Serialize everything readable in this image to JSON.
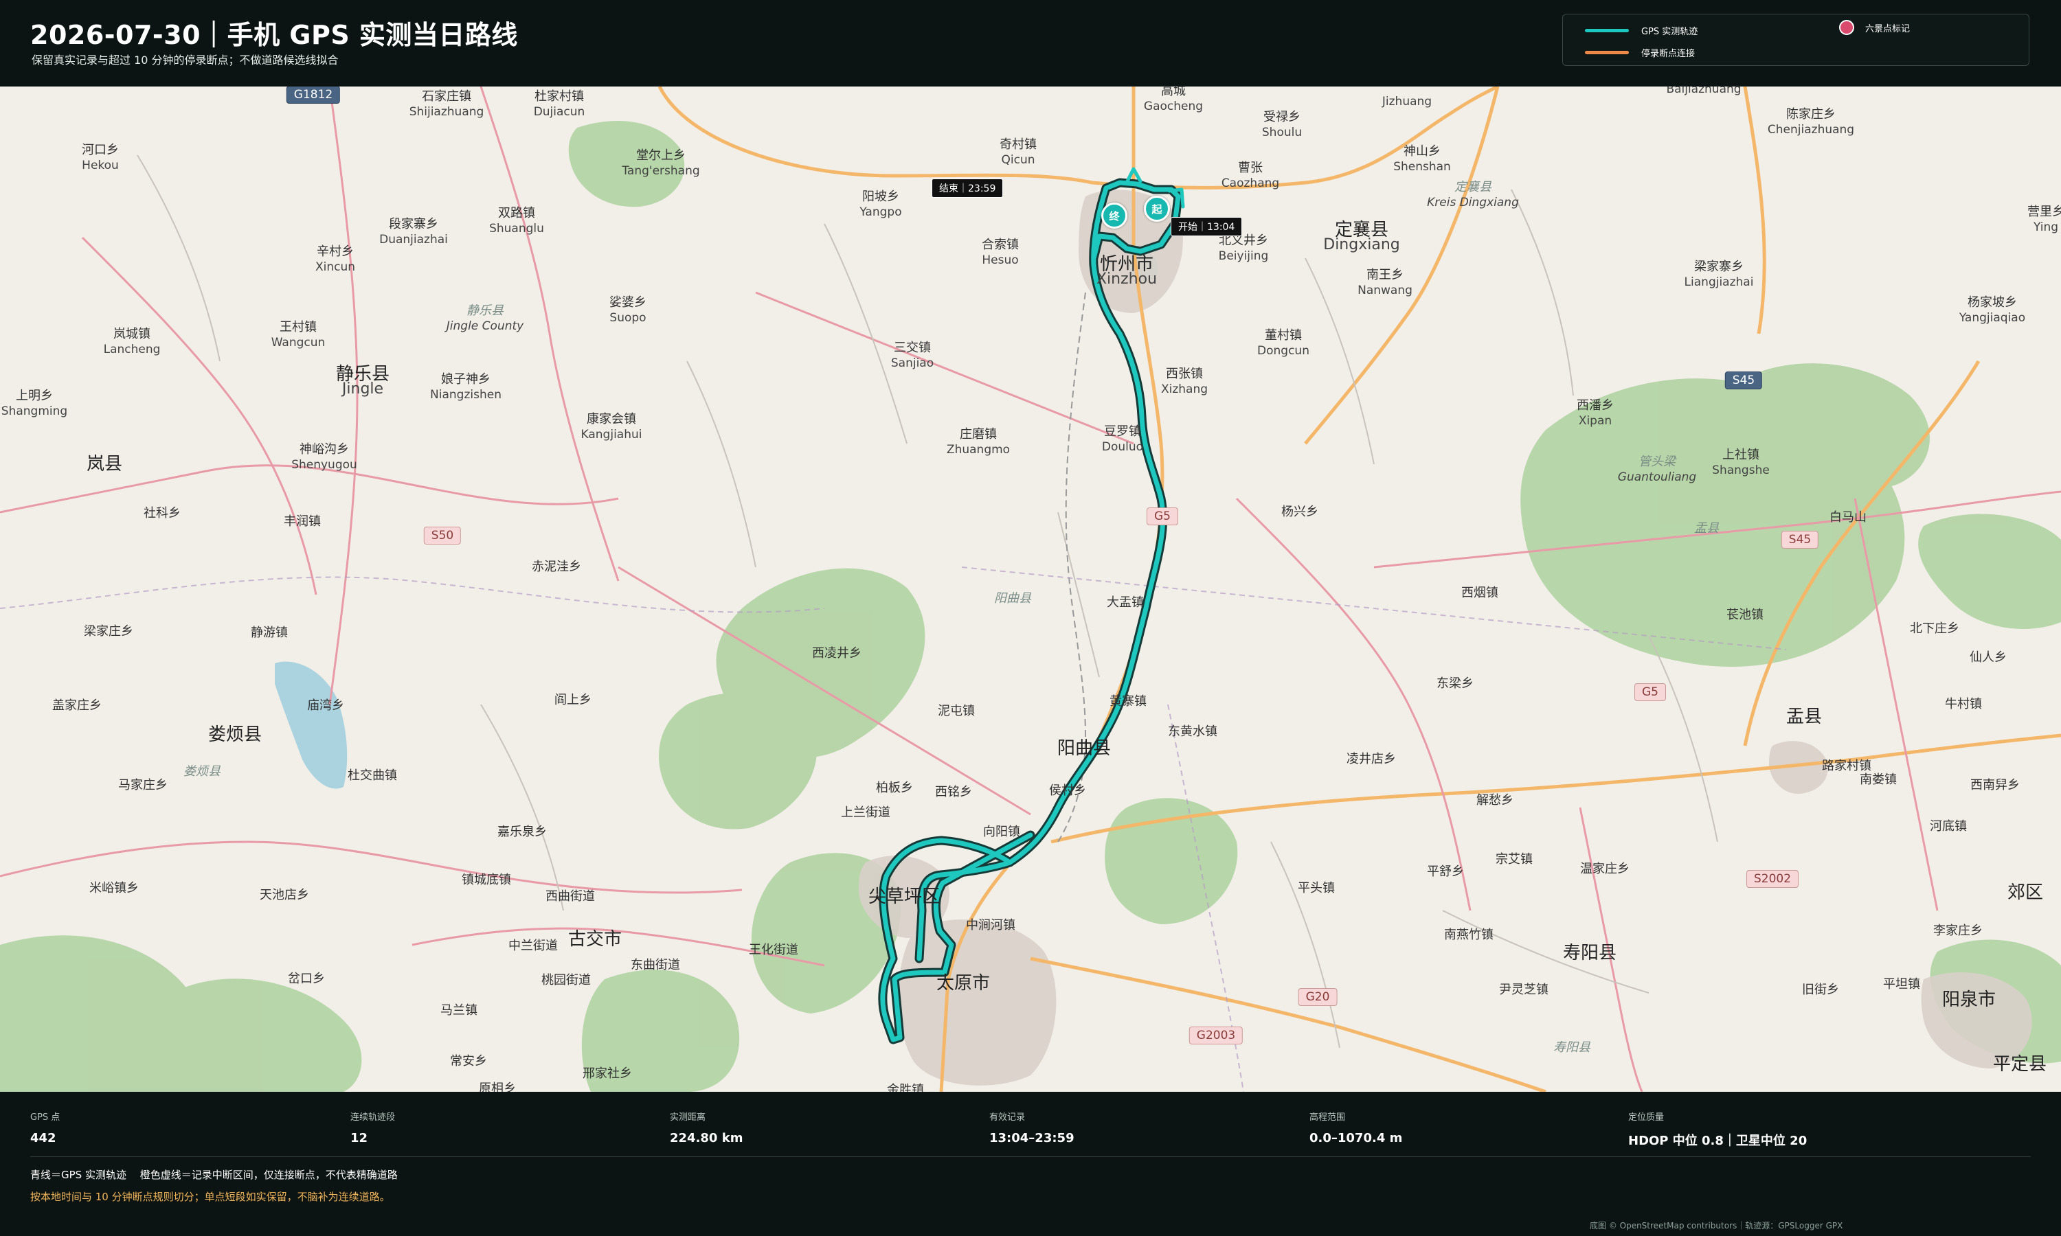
{
  "header": {
    "title": "2026-07-30｜手机 GPS 实测当日路线",
    "subtitle": "保留真实记录与超过 10 分钟的停录断点；不做道路候选线拟合"
  },
  "legend": {
    "gps_track": "GPS 实测轨迹",
    "gap_connector": "停录断点连接",
    "landmark": "六景点标记",
    "colors": {
      "track": "#1ec8be",
      "gap": "#f08a4b",
      "landmark": "#d94a6e"
    }
  },
  "map": {
    "markers": {
      "start_badge": "起",
      "end_badge": "终"
    },
    "tags": {
      "start": "开始｜13:04",
      "end": "结束｜23:59"
    },
    "shields": [
      {
        "id": "g1812",
        "label": "G1812",
        "kind": "g"
      },
      {
        "id": "s45a",
        "label": "S45",
        "kind": "g"
      },
      {
        "id": "s50",
        "label": "S50",
        "kind": "s"
      },
      {
        "id": "s45b",
        "label": "S45",
        "kind": "s"
      },
      {
        "id": "g5a",
        "label": "G5",
        "kind": "s"
      },
      {
        "id": "g5b",
        "label": "G5",
        "kind": "s"
      },
      {
        "id": "s2002",
        "label": "S2002",
        "kind": "s"
      },
      {
        "id": "g20",
        "label": "G20",
        "kind": "s"
      },
      {
        "id": "g2003",
        "label": "G2003",
        "kind": "s"
      }
    ],
    "places": [
      {
        "id": "p1",
        "zh": "石家庄镇",
        "py": "Shijiazhuang"
      },
      {
        "id": "p2",
        "zh": "杜家村镇",
        "py": "Dujiacun"
      },
      {
        "id": "p3",
        "zh": "河口乡",
        "py": "Hekou"
      },
      {
        "id": "p4",
        "zh": "堂尔上乡",
        "py": "Tang'ershang"
      },
      {
        "id": "p5",
        "zh": "奇村镇",
        "py": "Qicun"
      },
      {
        "id": "p6",
        "zh": "高城",
        "py": "Gaocheng"
      },
      {
        "id": "p7",
        "zh": "受禄乡",
        "py": "Shoulu"
      },
      {
        "id": "p8",
        "zh": "",
        "py": "Jizhuang"
      },
      {
        "id": "p9",
        "zh": "神山乡",
        "py": "Shenshan"
      },
      {
        "id": "p10",
        "zh": "",
        "py": "Baijiazhuang"
      },
      {
        "id": "p11",
        "zh": "陈家庄乡",
        "py": "Chenjiazhuang"
      },
      {
        "id": "p12",
        "zh": "段家寨乡",
        "py": "Duanjiazhai"
      },
      {
        "id": "p13",
        "zh": "双路镇",
        "py": "Shuanglu"
      },
      {
        "id": "p14",
        "zh": "阳坡乡",
        "py": "Yangpo"
      },
      {
        "id": "p15",
        "zh": "曹张",
        "py": "Caozhang"
      },
      {
        "id": "p16",
        "zh": "合索镇",
        "py": "Hesuo"
      },
      {
        "id": "p17",
        "zh": "北义井乡",
        "py": "Beiyijing"
      },
      {
        "id": "p18",
        "zh": "辛村乡",
        "py": "Xincun"
      },
      {
        "id": "p19",
        "zh": "南王乡",
        "py": "Nanwang"
      },
      {
        "id": "p20",
        "zh": "梁家寨乡",
        "py": "Liangjiazhai"
      },
      {
        "id": "p21",
        "zh": "杨家坡乡",
        "py": "Yangjiaqiao"
      },
      {
        "id": "p22",
        "zh": "营里乡",
        "py": "Ying"
      },
      {
        "id": "p23",
        "zh": "岚城镇",
        "py": "Lancheng"
      },
      {
        "id": "p24",
        "zh": "王村镇",
        "py": "Wangcun"
      },
      {
        "id": "p25",
        "zh": "娑婆乡",
        "py": "Suopo"
      },
      {
        "id": "p26",
        "zh": "三交镇",
        "py": "Sanjiao"
      },
      {
        "id": "p27",
        "zh": "董村镇",
        "py": "Dongcun"
      },
      {
        "id": "p28",
        "zh": "娘子神乡",
        "py": "Niangzishen"
      },
      {
        "id": "p29",
        "zh": "西张镇",
        "py": "Xizhang"
      },
      {
        "id": "p30",
        "zh": "上明乡",
        "py": "Shangming"
      },
      {
        "id": "p31",
        "zh": "康家会镇",
        "py": "Kangjiahui"
      },
      {
        "id": "p32",
        "zh": "庄磨镇",
        "py": "Zhuangmo"
      },
      {
        "id": "p33",
        "zh": "豆罗镇",
        "py": "Douluo"
      },
      {
        "id": "p34",
        "zh": "西潘乡",
        "py": "Xipan"
      },
      {
        "id": "p35",
        "zh": "上社镇",
        "py": "Shangshe"
      },
      {
        "id": "p36",
        "zh": "神峪沟乡",
        "py": "Shenyugou"
      },
      {
        "id": "p37",
        "zh": "杨兴乡",
        "py": ""
      },
      {
        "id": "p38",
        "zh": "社科乡",
        "py": ""
      },
      {
        "id": "p39",
        "zh": "丰润镇",
        "py": ""
      },
      {
        "id": "p40",
        "zh": "白马山",
        "py": ""
      },
      {
        "id": "p41",
        "zh": "赤泥洼乡",
        "py": ""
      },
      {
        "id": "p42",
        "zh": "大盂镇",
        "py": ""
      },
      {
        "id": "p43",
        "zh": "西烟镇",
        "py": ""
      },
      {
        "id": "p44",
        "zh": "苌池镇",
        "py": ""
      },
      {
        "id": "p45",
        "zh": "北下庄乡",
        "py": ""
      },
      {
        "id": "p46",
        "zh": "梁家庄乡",
        "py": ""
      },
      {
        "id": "p47",
        "zh": "静游镇",
        "py": ""
      },
      {
        "id": "p48",
        "zh": "西凌井乡",
        "py": ""
      },
      {
        "id": "p49",
        "zh": "仙人乡",
        "py": ""
      },
      {
        "id": "p50",
        "zh": "东梁乡",
        "py": ""
      },
      {
        "id": "p51",
        "zh": "黄寨镇",
        "py": ""
      },
      {
        "id": "p52",
        "zh": "盖家庄乡",
        "py": ""
      },
      {
        "id": "p53",
        "zh": "阎上乡",
        "py": ""
      },
      {
        "id": "p54",
        "zh": "泥屯镇",
        "py": ""
      },
      {
        "id": "p55",
        "zh": "庙湾乡",
        "py": ""
      },
      {
        "id": "p56",
        "zh": "东黄水镇",
        "py": ""
      },
      {
        "id": "p57",
        "zh": "牛村镇",
        "py": ""
      },
      {
        "id": "p58",
        "zh": "凌井店乡",
        "py": ""
      },
      {
        "id": "p59",
        "zh": "杜交曲镇",
        "py": ""
      },
      {
        "id": "p60",
        "zh": "马家庄乡",
        "py": ""
      },
      {
        "id": "p61",
        "zh": "柏板乡",
        "py": ""
      },
      {
        "id": "p62",
        "zh": "西铭乡",
        "py": ""
      },
      {
        "id": "p63",
        "zh": "侯村乡",
        "py": ""
      },
      {
        "id": "p64",
        "zh": "南娄镇",
        "py": ""
      },
      {
        "id": "p65",
        "zh": "路家村镇",
        "py": ""
      },
      {
        "id": "p66",
        "zh": "解愁乡",
        "py": ""
      },
      {
        "id": "p67",
        "zh": "西南舁乡",
        "py": ""
      },
      {
        "id": "p68",
        "zh": "上兰街道",
        "py": ""
      },
      {
        "id": "p69",
        "zh": "嘉乐泉乡",
        "py": ""
      },
      {
        "id": "p70",
        "zh": "向阳镇",
        "py": ""
      },
      {
        "id": "p71",
        "zh": "河底镇",
        "py": ""
      },
      {
        "id": "p72",
        "zh": "平舒乡",
        "py": ""
      },
      {
        "id": "p73",
        "zh": "宗艾镇",
        "py": ""
      },
      {
        "id": "p74",
        "zh": "温家庄乡",
        "py": ""
      },
      {
        "id": "p75",
        "zh": "镇城底镇",
        "py": ""
      },
      {
        "id": "p76",
        "zh": "西曲街道",
        "py": ""
      },
      {
        "id": "p77",
        "zh": "平头镇",
        "py": ""
      },
      {
        "id": "p78",
        "zh": "米峪镇乡",
        "py": ""
      },
      {
        "id": "p79",
        "zh": "天池店乡",
        "py": ""
      },
      {
        "id": "p80",
        "zh": "中涧河镇",
        "py": ""
      },
      {
        "id": "p81",
        "zh": "南燕竹镇",
        "py": ""
      },
      {
        "id": "p82",
        "zh": "李家庄乡",
        "py": ""
      },
      {
        "id": "p83",
        "zh": "中兰街道",
        "py": ""
      },
      {
        "id": "p84",
        "zh": "王化街道",
        "py": ""
      },
      {
        "id": "p85",
        "zh": "桃园街道",
        "py": ""
      },
      {
        "id": "p86",
        "zh": "东曲街道",
        "py": ""
      },
      {
        "id": "p87",
        "zh": "尹灵芝镇",
        "py": ""
      },
      {
        "id": "p88",
        "zh": "旧街乡",
        "py": ""
      },
      {
        "id": "p89",
        "zh": "平坦镇",
        "py": ""
      },
      {
        "id": "p90",
        "zh": "岔口乡",
        "py": ""
      },
      {
        "id": "p91",
        "zh": "马兰镇",
        "py": ""
      },
      {
        "id": "p92",
        "zh": "常安乡",
        "py": ""
      },
      {
        "id": "p93",
        "zh": "邢家社乡",
        "py": ""
      },
      {
        "id": "p94",
        "zh": "原相乡",
        "py": ""
      },
      {
        "id": "p95",
        "zh": "金胜镇",
        "py": ""
      },
      {
        "id": "p96",
        "zh": "平定县",
        "py": ""
      },
      {
        "id": "p97",
        "zh": "郊区",
        "py": ""
      }
    ],
    "cities": [
      {
        "id": "c1",
        "zh": "定襄县",
        "py": "Dingxiang"
      },
      {
        "id": "c2",
        "zh": "静乐县",
        "py": "Jingle"
      },
      {
        "id": "c3",
        "zh": "岚县",
        "py": ""
      },
      {
        "id": "c4",
        "zh": "忻州市",
        "py": "Xinzhou"
      },
      {
        "id": "c5",
        "zh": "盂县",
        "py": ""
      },
      {
        "id": "c6",
        "zh": "娄烦县",
        "py": ""
      },
      {
        "id": "c7",
        "zh": "阳曲县",
        "py": ""
      },
      {
        "id": "c8",
        "zh": "古交市",
        "py": ""
      },
      {
        "id": "c9",
        "zh": "尖草坪区",
        "py": ""
      },
      {
        "id": "c10",
        "zh": "太原市",
        "py": ""
      },
      {
        "id": "c11",
        "zh": "寿阳县",
        "py": ""
      },
      {
        "id": "c12",
        "zh": "阳泉市",
        "py": ""
      }
    ],
    "muted": [
      {
        "id": "m1",
        "zh": "静乐县",
        "py": "Jingle County"
      },
      {
        "id": "m2",
        "zh": "定襄县",
        "py": "Kreis Dingxiang"
      },
      {
        "id": "m3",
        "zh": "管头梁",
        "py": "Guantouliang"
      },
      {
        "id": "m4",
        "zh": "阳曲县",
        "py": ""
      },
      {
        "id": "m5",
        "zh": "娄烦县",
        "py": ""
      },
      {
        "id": "m6",
        "zh": "盂县",
        "py": ""
      },
      {
        "id": "m7",
        "zh": "寿阳县",
        "py": ""
      }
    ]
  },
  "stats": [
    {
      "label": "GPS 点",
      "value": "442"
    },
    {
      "label": "连续轨迹段",
      "value": "12"
    },
    {
      "label": "实测距离",
      "value": "224.80 km"
    },
    {
      "label": "有效记录",
      "value": "13:04–23:59"
    },
    {
      "label": "高程范围",
      "value": "0.0–1070.4 m"
    },
    {
      "label": "定位质量",
      "value": "HDOP 中位 0.8｜卫星中位 20"
    }
  ],
  "notes": {
    "line1": "青线＝GPS 实测轨迹　 橙色虚线＝记录中断区间，仅连接断点，不代表精确道路",
    "line2": "按本地时间与 10 分钟断点规则切分；单点短段如实保留，不脑补为连续道路。"
  },
  "attribution": "底图 © OpenStreetMap contributors｜轨迹源：GPSLogger GPX"
}
